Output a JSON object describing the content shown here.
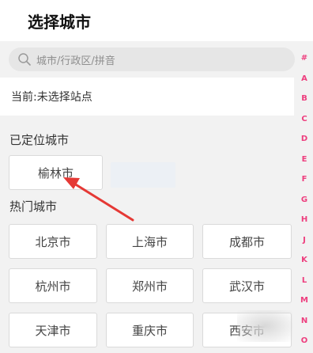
{
  "header": {
    "title": "选择城市"
  },
  "search": {
    "placeholder": "城市/行政区/拼音",
    "icon": "search-icon"
  },
  "current": {
    "text": "当前:未选择站点"
  },
  "located": {
    "title": "已定位城市",
    "city": "榆林市"
  },
  "hot": {
    "title": "热门城市",
    "cities": [
      "北京市",
      "上海市",
      "成都市",
      "杭州市",
      "郑州市",
      "武汉市",
      "天津市",
      "重庆市",
      "西安市"
    ]
  },
  "index_letters": [
    "#",
    "A",
    "B",
    "C",
    "D",
    "E",
    "F",
    "G",
    "H",
    "J",
    "K",
    "L",
    "M",
    "N",
    "O"
  ],
  "colors": {
    "index_accent": "#ee3e7e",
    "annotation_arrow": "#e53935"
  }
}
